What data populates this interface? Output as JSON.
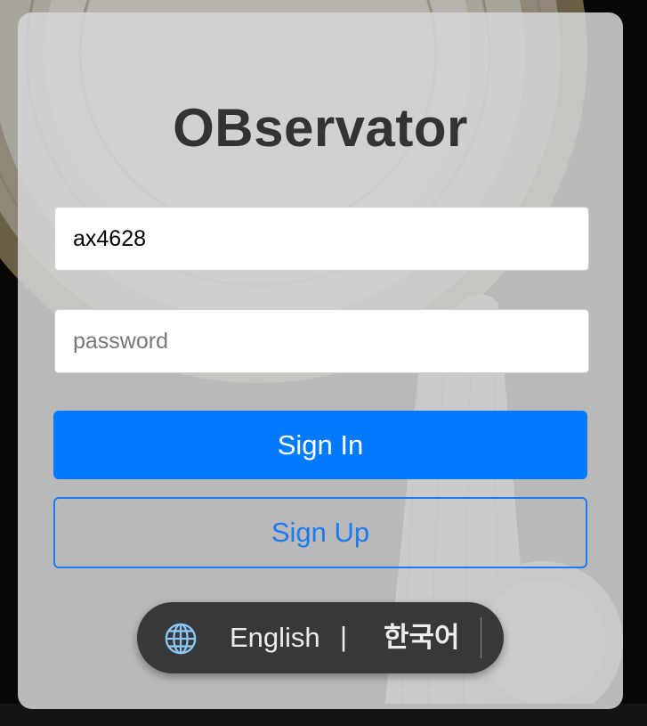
{
  "app": {
    "title": "OBservator"
  },
  "login": {
    "username_value": "ax4628",
    "password_placeholder": "password",
    "signin_label": "Sign In",
    "signup_label": "Sign Up"
  },
  "language": {
    "icon": "globe-icon",
    "english_label": "English",
    "separator": "|",
    "korean_label": "한국어"
  },
  "colors": {
    "primary": "#007bff",
    "title": "#333333",
    "lang_bar": "#383838",
    "globe": "#8cc8f5"
  }
}
